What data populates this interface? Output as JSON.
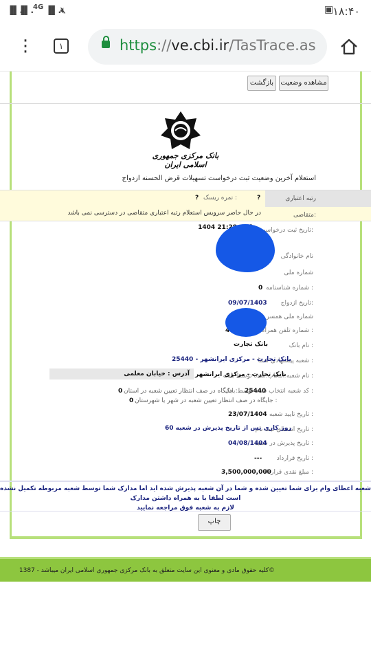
{
  "status_bar": {
    "time": "۱۸:۴۰",
    "network": "4G"
  },
  "browser": {
    "tab_count": "۱",
    "url_scheme": "https",
    "url_host": "ve.cbi.ir",
    "url_path": "/TasTrace.as"
  },
  "toolbar": {
    "view_status_label": "مشاهده وضعیت",
    "back_label": "بازگشت"
  },
  "header": {
    "logo_text": "بانک مرکزی جمهوری اسلامی ایران",
    "page_title": "استعلام آخرین وضعیت ثبت درخواست تسهیلات قرض الحسنه ازدواج"
  },
  "credit": {
    "rank_label": "رتبه اعتباری متقاضی:",
    "rank_value": "?",
    "score_label": "نمره ریسک :",
    "score_value": "?",
    "unavailable_msg": "در حال حاضر سرویس استعلام رتبه اعتباری متقاضی در دسترسی نمی باشد"
  },
  "fields": {
    "request_date_label": "تاریخ ثبت درخواست:",
    "request_date_value": "1404 ساعت 21:28",
    "last_name_label": "نام خانوادگی",
    "national_id_label": "شماره ملی",
    "id_number_label": "شماره شناسنامه :",
    "id_number_value": "0",
    "marriage_date_label": "تاریخ ازدواج:",
    "marriage_date_value": "09/07/1403",
    "spouse_nid_label": "شماره ملی همسر",
    "mobile_label": "شماره تلفن همراه :",
    "mobile_value": "4",
    "bank_name_label": "نام بانک :",
    "bank_name_value": "بانک تجارت",
    "suggested_branch_label": "شعبه پیشنهادی شما :",
    "suggested_branch_value": "بانک تجارت - مرکزی ایرانشهر - 25440",
    "selected_branch_label": "نام شعبه انتخاب شده توسط بانک :",
    "selected_branch_value": "بانک تجارت - مرکزی ایرانشهر",
    "branch_address_value": "آدرس : خیابان معلمی",
    "branch_code_label": "کد شعبه انتخاب شده توسط بانک :",
    "branch_code_value": "25440",
    "province_queue_label": "جایگاه در صف انتظار تعیین شعبه در استان :",
    "province_queue_value": "0",
    "city_queue_label": "جایگاه در صف انتظار تعیین شعبه در شهر یا شهرستان :",
    "city_queue_value": "0",
    "branch_confirm_label": "تاریخ تایید شعبه :",
    "branch_confirm_value": "23/07/1404",
    "registration_expiry_label": "تاریخ انقضای ثبت نام :",
    "registration_expiry_value": "60 روز کاری پس از تاریخ پذیرش در شعبه",
    "branch_accept_label": "تاریخ پذیرش در شعبه :",
    "branch_accept_value": "04/08/1404",
    "contract_date_label": "تاریخ قرارداد :",
    "contract_date_value": "---",
    "amount_label": "مبلغ نقدی قرارداد :",
    "amount_value": "3,500,000,000"
  },
  "notice": {
    "line1": "شعبه اعطای وام برای شما تعیین شده و شما در آن شعبه پذیرش شده اید اما مدارک شما توسط شعبه مربوطه تکمیل نشده است لطفا با به همراه داشتن مدارک",
    "line2": "لازم به شعبه فوق مراجعه نمایید"
  },
  "print": {
    "label": "چاپ"
  },
  "footer": {
    "rights": "کلیه حقوق مادی و معنوی این سایت متعلق به بانک مرکزی جمهوری اسلامی ایران میباشد - 1387©"
  }
}
